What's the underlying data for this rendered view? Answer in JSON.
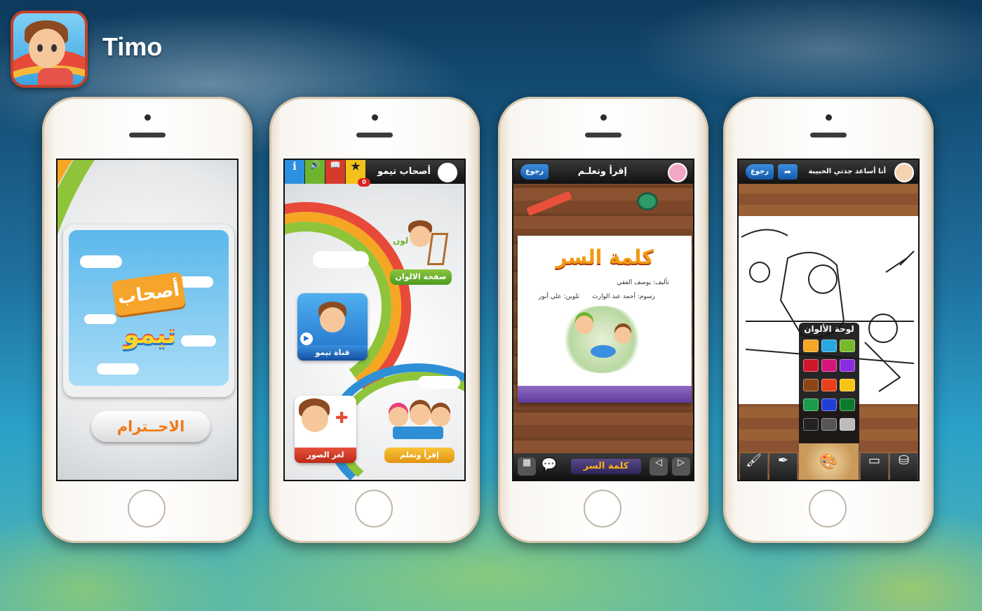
{
  "app": {
    "name": "Timo"
  },
  "screen1": {
    "logo_top": "أصحاب",
    "logo_bottom": "تيمو",
    "button_label": "الاحــترام"
  },
  "screen2": {
    "title": "أصحاب تيمو",
    "toolbar": {
      "info": "i",
      "sound": "🔊",
      "book": "📖",
      "star": "★",
      "badge_count": "0"
    },
    "cards": {
      "colors": "صفحة الالوان",
      "channel": "قناة تيمو",
      "puzzle": "لغز الصور",
      "read": "إقرأ وتعلم"
    },
    "colors_badge": "لون"
  },
  "screen3": {
    "title": "إقرأ وتعلـم",
    "back_label": "رجوع",
    "book_title": "كلمة السر",
    "author": "تأليف: يوسف الفقي",
    "illustrator": "رسوم: أحمد عبد الوارث",
    "colorist": "تلوين: علي أنور",
    "footer_caption": "كلمة السر"
  },
  "screen4": {
    "title": "أنا أساعد جدتي الحبيبة",
    "back_label": "رجوع",
    "palette_title": "لوحة الألوان",
    "palette_colors": [
      "#f5a623",
      "#29a8e0",
      "#78b82a",
      "#d0162b",
      "#d2167a",
      "#8a2be2",
      "#8b4513",
      "#e8401c",
      "#f7c414",
      "#1a9c4a",
      "#1f3fd6",
      "#0c7a2c",
      "#222222",
      "#555555",
      "#bbbbbb"
    ]
  }
}
